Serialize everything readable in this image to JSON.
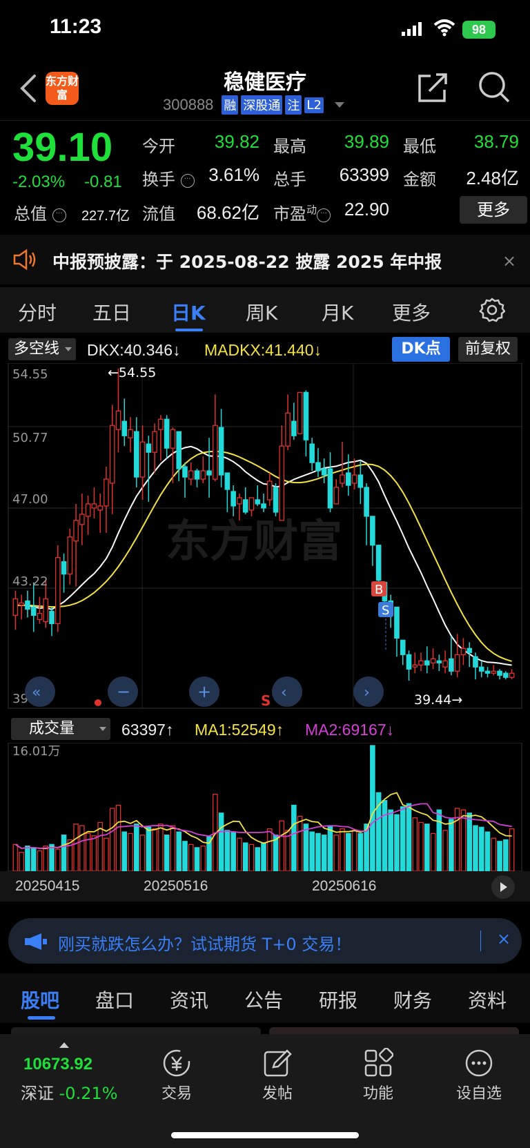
{
  "status": {
    "time": "11:23",
    "battery": "98"
  },
  "header": {
    "logo_text": "东方财富",
    "stock_name": "稳健医疗",
    "stock_code": "300888",
    "tags": [
      "融",
      "深股通",
      "注",
      "L2"
    ]
  },
  "quote": {
    "price": "39.10",
    "change_pct": "-2.03%",
    "change_amt": "-0.81",
    "open_label": "今开",
    "open": "39.82",
    "high_label": "最高",
    "high": "39.89",
    "low_label": "最低",
    "low": "38.79",
    "turnover_label": "换手",
    "turnover": "3.61%",
    "volume_label": "总手",
    "volume": "63399",
    "amount_label": "金额",
    "amount": "2.48亿",
    "mktcap_label": "总值",
    "mktcap": "227.7亿",
    "float_label": "流值",
    "float": "68.62亿",
    "pe_label": "市盈",
    "pe_sup": "动",
    "pe": "22.90",
    "more_label": "更多"
  },
  "notice": {
    "text": "中报预披露：于 2025-08-22 披露 2025 年中报",
    "close": "×"
  },
  "period_tabs": [
    {
      "label": "分时"
    },
    {
      "label": "五日"
    },
    {
      "label": "日K"
    },
    {
      "label": "周K"
    },
    {
      "label": "月K"
    },
    {
      "label": "更多"
    }
  ],
  "indicator": {
    "selector": "多空线",
    "dkx": "DKX:40.346↓",
    "madkx": "MADKX:41.440↓",
    "dk_button": "DK点",
    "adjust_button": "前复权"
  },
  "kline": {
    "y_labels": [
      "54.55",
      "50.77",
      "47.00",
      "43.22",
      "39.44"
    ],
    "max_marker": "←54.55",
    "min_marker": "39.44→",
    "watermark": "东方财富"
  },
  "volume": {
    "selector": "成交量",
    "value": "63397↑",
    "ma1": "MA1:52549↑",
    "ma2": "MA2:69167↓",
    "y_label": "16.01万"
  },
  "dates": [
    "20250415",
    "20250516",
    "20250616"
  ],
  "ad": {
    "text": "刚买就跌怎么办？试试期货 T+0 交易！",
    "close": "×"
  },
  "bottom_tabs": [
    {
      "label": "股吧"
    },
    {
      "label": "盘口"
    },
    {
      "label": "资讯"
    },
    {
      "label": "公告"
    },
    {
      "label": "研报"
    },
    {
      "label": "财务"
    },
    {
      "label": "资料"
    }
  ],
  "dock": {
    "index_value": "10673.92",
    "index_name": "深证",
    "index_change": "-0.21%",
    "items": [
      {
        "label": "交易",
        "icon": "yen-exchange-icon"
      },
      {
        "label": "发帖",
        "icon": "edit-post-icon"
      },
      {
        "label": "功能",
        "icon": "grid-apps-icon"
      },
      {
        "label": "设自选",
        "icon": "add-watchlist-icon"
      }
    ]
  },
  "colors": {
    "up": "#e0332b",
    "down": "#23d9d9",
    "price_down": "#1fdf3a",
    "accent": "#3a7ff6",
    "dkx": "#ffffff",
    "madkx": "#f5e33f",
    "ma2": "#d63fd6"
  },
  "chart_data": {
    "type": "candlestick",
    "ylim": [
      39.44,
      54.55
    ],
    "candles": [
      [
        42.6,
        43.4,
        43.8,
        41.9
      ],
      [
        43.1,
        43.2,
        43.6,
        42.4
      ],
      [
        43.3,
        42.9,
        43.8,
        42.5
      ],
      [
        43.0,
        42.6,
        44.2,
        41.8
      ],
      [
        42.4,
        42.7,
        43.5,
        42.2
      ],
      [
        42.3,
        43.4,
        44.3,
        42.0
      ],
      [
        42.8,
        42.2,
        43.0,
        41.6
      ],
      [
        42.2,
        45.4,
        46.0,
        41.8
      ],
      [
        45.2,
        44.6,
        45.6,
        43.7
      ],
      [
        44.6,
        46.4,
        46.8,
        44.1
      ],
      [
        46.2,
        47.2,
        48.0,
        44.0
      ],
      [
        47.0,
        47.5,
        48.5,
        46.0
      ],
      [
        47.4,
        48.0,
        48.4,
        46.5
      ],
      [
        47.8,
        48.0,
        48.8,
        47.3
      ],
      [
        47.7,
        47.9,
        48.5,
        46.6
      ],
      [
        47.9,
        49.2,
        49.8,
        46.6
      ],
      [
        49.0,
        51.8,
        52.8,
        47.5
      ],
      [
        51.6,
        52.5,
        54.55,
        50.5
      ],
      [
        52.0,
        51.3,
        53.1,
        50.8
      ],
      [
        51.2,
        51.6,
        52.2,
        50.5
      ],
      [
        51.5,
        49.3,
        52.2,
        48.8
      ],
      [
        49.3,
        51.0,
        51.8,
        48.2
      ],
      [
        50.9,
        50.5,
        51.3,
        48.1
      ],
      [
        50.5,
        51.5,
        51.9,
        49.5
      ],
      [
        51.6,
        52.1,
        52.3,
        50.1
      ],
      [
        52.1,
        50.7,
        52.3,
        50.2
      ],
      [
        50.7,
        51.6,
        51.7,
        49.0
      ],
      [
        51.5,
        49.7,
        51.5,
        49.1
      ],
      [
        49.8,
        49.3,
        50.0,
        48.3
      ],
      [
        49.2,
        49.6,
        50.0,
        48.9
      ],
      [
        49.6,
        49.2,
        49.7,
        48.8
      ],
      [
        49.2,
        49.6,
        50.3,
        49.0
      ],
      [
        49.6,
        49.4,
        51.2,
        48.3
      ],
      [
        49.2,
        51.8,
        53.3,
        49.1
      ],
      [
        51.7,
        49.4,
        52.6,
        48.8
      ],
      [
        49.5,
        48.7,
        49.5,
        47.6
      ],
      [
        48.6,
        47.9,
        48.9,
        47.4
      ],
      [
        48.0,
        48.3,
        48.5,
        47.2
      ],
      [
        48.2,
        47.6,
        48.8,
        47.5
      ],
      [
        47.7,
        48.3,
        48.3,
        47.4
      ],
      [
        48.2,
        48.0,
        48.9,
        47.9
      ],
      [
        48.0,
        47.8,
        48.5,
        47.6
      ],
      [
        48.2,
        49.1,
        49.5,
        47.9
      ],
      [
        48.8,
        47.6,
        49.0,
        47.4
      ],
      [
        47.2,
        50.8,
        51.8,
        47.2
      ],
      [
        50.8,
        52.4,
        53.3,
        50.6
      ],
      [
        52.0,
        51.3,
        52.9,
        51.1
      ],
      [
        51.4,
        53.4,
        53.4,
        51.4
      ],
      [
        53.4,
        51.1,
        53.5,
        50.3
      ],
      [
        50.9,
        50.0,
        51.2,
        49.6
      ],
      [
        50.0,
        49.6,
        50.7,
        49.3
      ],
      [
        49.7,
        49.4,
        50.2,
        49.0
      ],
      [
        49.7,
        47.8,
        50.5,
        47.6
      ],
      [
        48.0,
        48.8,
        49.2,
        48.0
      ],
      [
        49.0,
        49.4,
        51.0,
        48.8
      ],
      [
        49.5,
        48.9,
        50.4,
        48.4
      ],
      [
        49.0,
        49.4,
        50.2,
        48.7
      ],
      [
        49.4,
        48.8,
        50.1,
        48.0
      ],
      [
        48.8,
        47.4,
        49.0,
        46.0
      ],
      [
        47.4,
        46.0,
        47.3,
        45.0
      ],
      [
        46.0,
        44.3,
        46.0,
        43.6
      ],
      [
        44.2,
        43.3,
        44.0,
        42.6
      ],
      [
        43.3,
        42.8,
        43.6,
        42.0
      ],
      [
        43.0,
        41.5,
        43.0,
        40.6
      ],
      [
        41.4,
        40.7,
        41.3,
        40.2
      ],
      [
        40.7,
        40.0,
        40.9,
        39.44
      ],
      [
        40.1,
        40.2,
        40.8,
        39.8
      ],
      [
        40.2,
        40.4,
        40.8,
        39.9
      ],
      [
        40.4,
        40.2,
        41.1,
        39.8
      ],
      [
        40.3,
        40.5,
        41.0,
        40.0
      ],
      [
        40.4,
        40.3,
        40.7,
        39.9
      ],
      [
        40.1,
        40.4,
        40.9,
        39.8
      ],
      [
        40.5,
        39.9,
        41.6,
        39.7
      ],
      [
        39.9,
        40.7,
        41.7,
        39.6
      ],
      [
        40.7,
        41.0,
        41.5,
        40.2
      ],
      [
        41.0,
        40.8,
        41.3,
        40.1
      ],
      [
        40.6,
        40.1,
        40.8,
        39.5
      ],
      [
        40.1,
        39.9,
        40.4,
        39.6
      ],
      [
        39.9,
        39.8,
        40.1,
        39.6
      ],
      [
        39.8,
        39.9,
        40.2,
        39.7
      ],
      [
        39.9,
        39.7,
        40.0,
        39.5
      ],
      [
        39.8,
        39.6,
        39.9,
        39.5
      ],
      [
        39.6,
        39.8,
        40.0,
        39.5
      ]
    ],
    "volume": [
      34,
      24,
      32,
      30,
      26,
      32,
      34,
      28,
      46,
      40,
      60,
      58,
      48,
      45,
      62,
      42,
      80,
      84,
      50,
      48,
      60,
      46,
      56,
      54,
      60,
      46,
      58,
      50,
      38,
      34,
      30,
      32,
      44,
      98,
      74,
      52,
      50,
      42,
      36,
      34,
      30,
      36,
      54,
      46,
      64,
      52,
      84,
      70,
      60,
      50,
      48,
      46,
      58,
      46,
      54,
      48,
      52,
      48,
      60,
      160,
      100,
      90,
      78,
      72,
      82,
      86,
      68,
      62,
      60,
      48,
      78,
      52,
      66,
      80,
      78,
      74,
      58,
      56,
      50,
      42,
      38,
      40,
      54
    ]
  }
}
